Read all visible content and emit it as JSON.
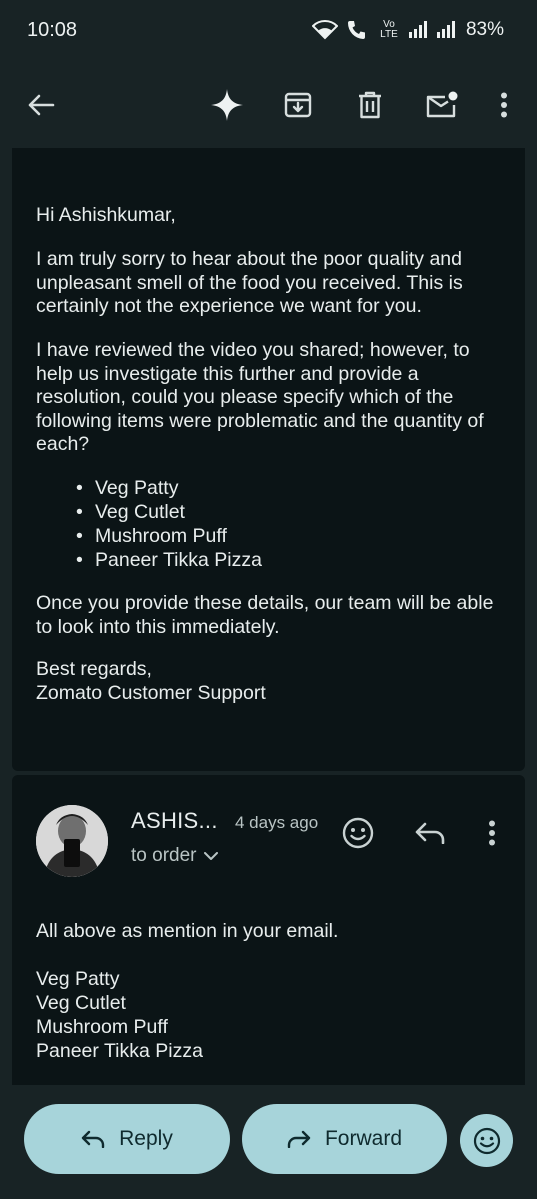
{
  "status_bar": {
    "time": "10:08",
    "network_label": "Vo LTE",
    "battery": "83%"
  },
  "toolbar": {
    "icons": [
      "back-arrow-icon",
      "sparkle-icon",
      "archive-icon",
      "delete-icon",
      "mark-unread-icon",
      "more-vert-icon"
    ]
  },
  "message1": {
    "greeting": "Hi Ashishkumar,",
    "paragraph1": "I am truly sorry to hear about the poor quality and unpleasant smell of the food you received. This is certainly not the experience we want for you.",
    "paragraph2": "I have reviewed the video you shared; however, to help us investigate this further and provide a resolution, could you please specify which of the following items were problematic and the quantity of each?",
    "items": [
      "Veg Patty",
      "Veg Cutlet",
      "Mushroom Puff",
      "Paneer Tikka Pizza"
    ],
    "paragraph3": "Once you provide these details, our team will be able to look into this immediately.",
    "signoff": "Best regards,",
    "signature": "Zomato Customer Support"
  },
  "message2": {
    "sender": "ASHIS...",
    "date": "4 days ago",
    "to": "to order",
    "line1": "All above as mention in your email.",
    "items": [
      "Veg Patty",
      "Veg Cutlet",
      "Mushroom Puff",
      "Paneer Tikka Pizza"
    ]
  },
  "actions": {
    "reply_label": "Reply",
    "forward_label": "Forward"
  },
  "colors": {
    "background": "#182325",
    "card": "#0b1416",
    "button": "#a7d4da",
    "text": "#e8eded"
  }
}
